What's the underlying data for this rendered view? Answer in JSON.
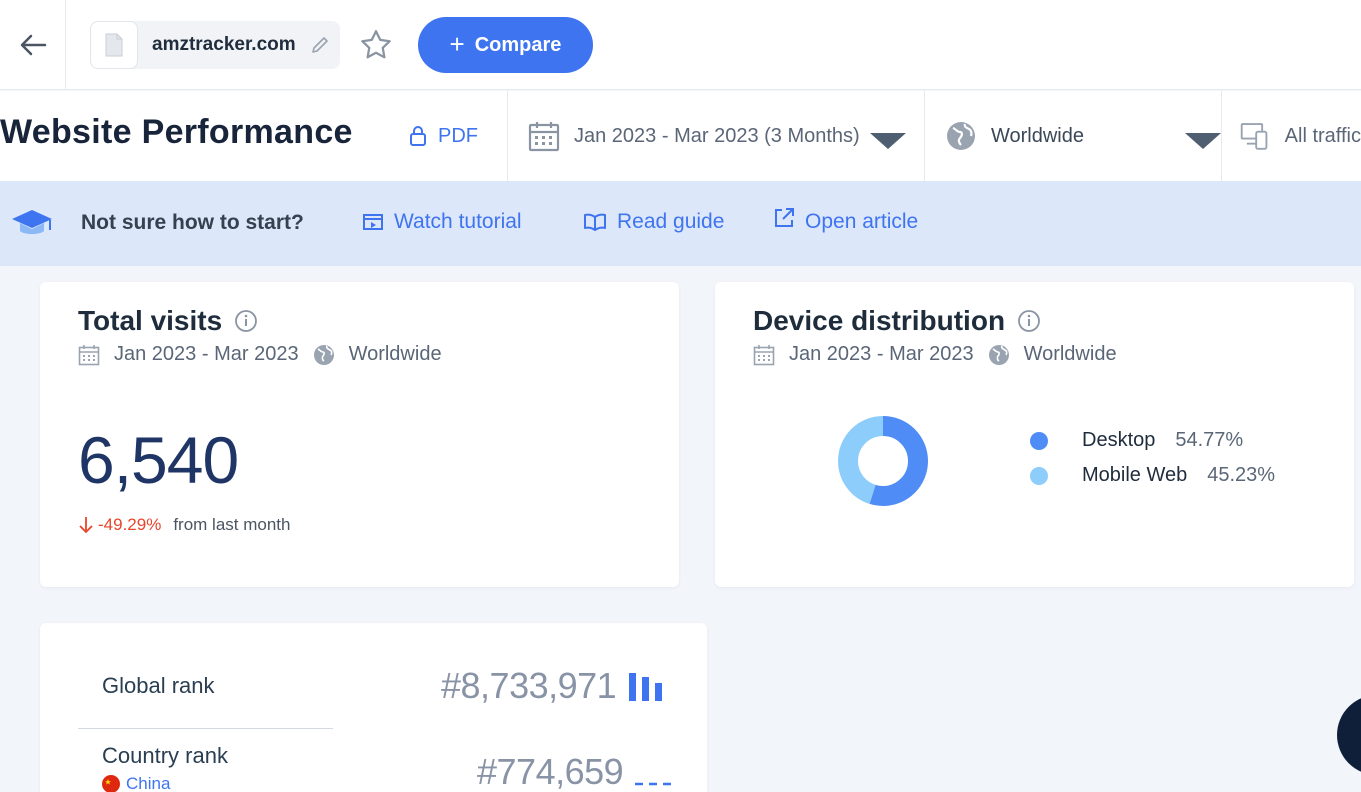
{
  "header": {
    "site_name": "amztracker.com",
    "compare_label": "Compare",
    "accent_color": "#3e74f0"
  },
  "filters": {
    "title": "Website Performance",
    "pdf_label": "PDF",
    "date_range": "Jan 2023 - Mar 2023 (3 Months)",
    "geo": "Worldwide",
    "traffic": "All traffic"
  },
  "banner": {
    "question": "Not sure how to start?",
    "watch_tutorial": "Watch tutorial",
    "read_guide": "Read guide",
    "open_article": "Open article"
  },
  "total_visits": {
    "title": "Total visits",
    "date": "Jan 2023 - Mar 2023",
    "geo": "Worldwide",
    "value": "6,540",
    "change": "-49.29%",
    "change_suffix": "from last month",
    "change_color": "#e8452b"
  },
  "device_distribution": {
    "title": "Device distribution",
    "date": "Jan 2023 - Mar 2023",
    "geo": "Worldwide",
    "items": [
      {
        "label": "Desktop",
        "pct": "54.77%",
        "value": 54.77,
        "color": "#4f8cf5"
      },
      {
        "label": "Mobile Web",
        "pct": "45.23%",
        "value": 45.23,
        "color": "#8ccdfb"
      }
    ]
  },
  "ranks": {
    "global_label": "Global rank",
    "global_value": "#8,733,971",
    "country_label": "Country rank",
    "country_name": "China",
    "country_value": "#774,659"
  }
}
